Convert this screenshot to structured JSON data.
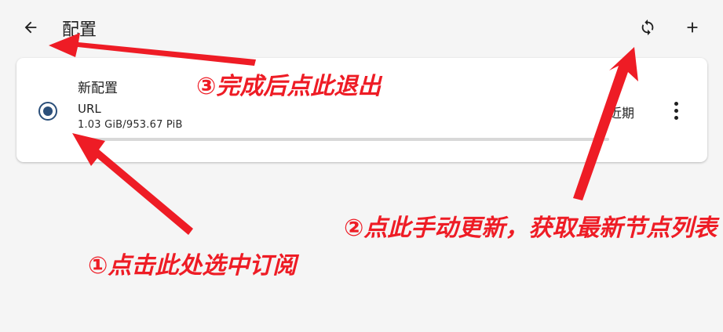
{
  "appbar": {
    "title": "配置",
    "back_icon": "arrow-back-icon",
    "sync_icon": "sync-icon",
    "add_icon": "plus-icon"
  },
  "profile": {
    "name": "新配置",
    "type": "URL",
    "usage": "1.03 GiB/953.67 PiB",
    "usage_fraction": 0.0,
    "update_time": "近期",
    "selected": true
  },
  "annotations": {
    "exit_note": "③完成后点此退出",
    "refresh_note": "②点此手动更新，获取最新节点列表",
    "select_note": "①点击此处选中订阅"
  },
  "colors": {
    "accent": "#2b4f7a",
    "annotation": "#ee1c25",
    "background": "#f5f5f5",
    "card": "#ffffff"
  }
}
